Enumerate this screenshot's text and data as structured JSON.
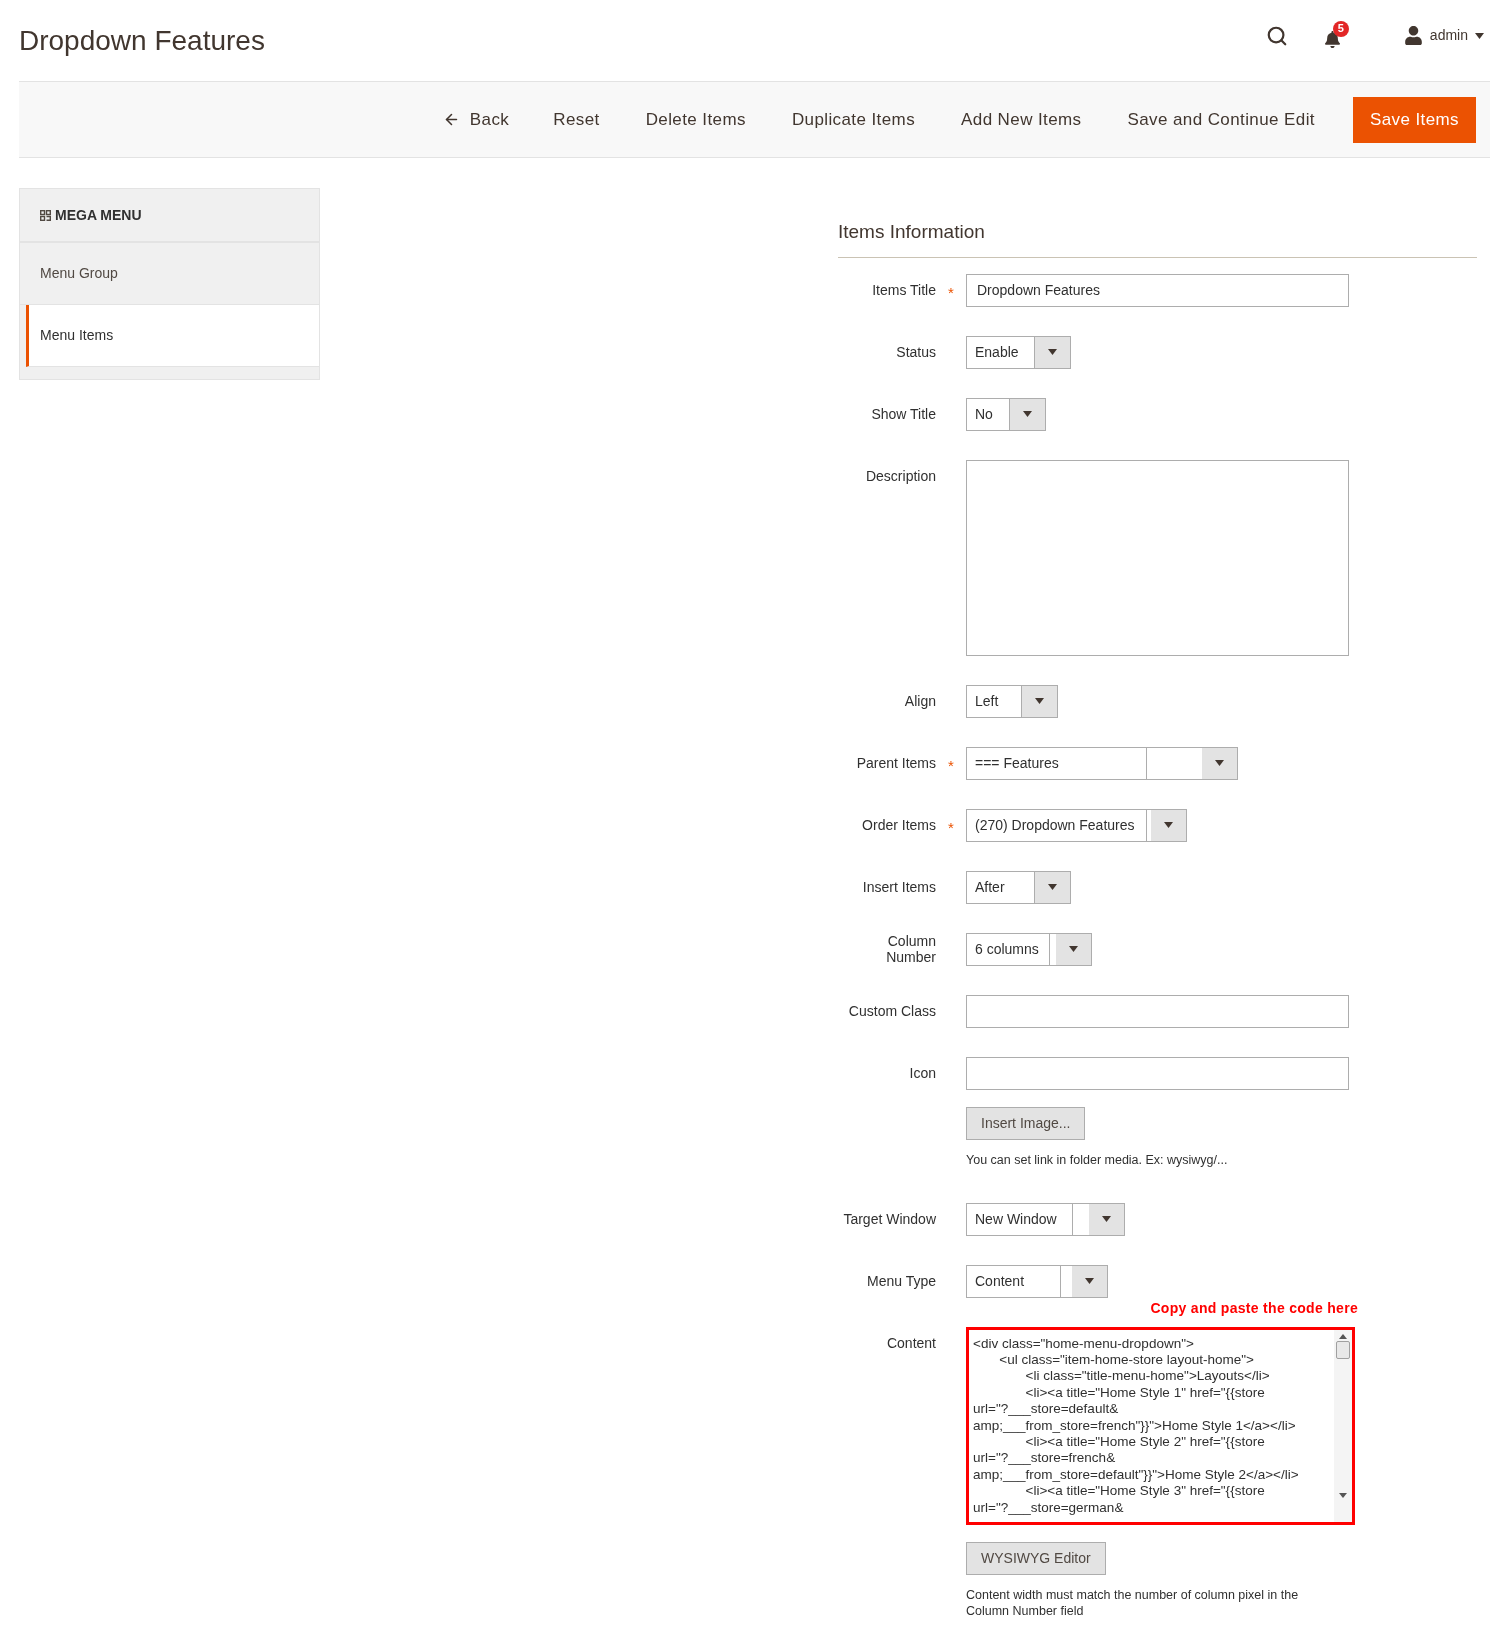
{
  "page_title": "Dropdown Features",
  "header": {
    "notifications": "5",
    "user": "admin"
  },
  "toolbar": [
    {
      "label": "Back",
      "kind": "back"
    },
    {
      "label": "Reset",
      "kind": "plain"
    },
    {
      "label": "Delete Items",
      "kind": "plain"
    },
    {
      "label": "Duplicate Items",
      "kind": "plain"
    },
    {
      "label": "Add New Items",
      "kind": "plain"
    },
    {
      "label": "Save and Continue Edit",
      "kind": "plain"
    },
    {
      "label": "Save Items",
      "kind": "primary"
    }
  ],
  "sidebar": {
    "title": "MEGA MENU",
    "items": [
      {
        "label": "Menu Group",
        "selected": false
      },
      {
        "label": "Menu Items",
        "selected": true
      }
    ]
  },
  "section_title": "Items Information",
  "fields": [
    {
      "label": "Items Title",
      "required_mark": "*",
      "kind": "text",
      "value": "Dropdown Features"
    },
    {
      "label": "Status",
      "kind": "select",
      "value": "Enable"
    },
    {
      "label": "Show Title",
      "kind": "select",
      "value": "No"
    },
    {
      "label": "Description",
      "kind": "textarea"
    },
    {
      "label": "Align",
      "kind": "select",
      "value": "Left"
    },
    {
      "label": "Parent Items",
      "required_mark": "*",
      "kind": "select",
      "value": "=== Features"
    },
    {
      "label": "Order Items",
      "required_mark": "*",
      "kind": "select",
      "value": "(270) Dropdown Features"
    },
    {
      "label": "Insert Items",
      "kind": "select",
      "value": "After"
    },
    {
      "label": "Column Number",
      "kind": "select",
      "value": "6 columns"
    },
    {
      "label": "Custom Class",
      "kind": "text"
    },
    {
      "label": "Icon",
      "kind": "text",
      "button": "Insert Image...",
      "note": "You can set link in folder media. Ex: wysiwyg/..."
    },
    {
      "label": "Target Window",
      "kind": "select",
      "value": "New Window"
    },
    {
      "label": "Menu Type",
      "kind": "select",
      "value": "Content"
    },
    {
      "label": "Content",
      "kind": "code",
      "highlighted": true,
      "annotation": "Copy and paste the code here",
      "value": "<div class=\"home-menu-dropdown\">\n\t<ul class=\"item-home-store layout-home\">\n\t\t<li class=\"title-menu-home\">Layouts</li>\n\t\t<li><a title=\"Home Style 1\" href=\"{{store\nurl=\"?___store=default&\namp;___from_store=french\"}}\">Home Style 1</a></li>\n\t\t<li><a title=\"Home Style 2\" href=\"{{store\nurl=\"?___store=french&\namp;___from_store=default\"}}\">Home Style 2</a></li>\n\t\t<li><a title=\"Home Style 3\" href=\"{{store\nurl=\"?___store=german&",
      "button": "WYSIWYG Editor",
      "note": "Content width must match the number of column pixel in the Column Number field"
    }
  ]
}
